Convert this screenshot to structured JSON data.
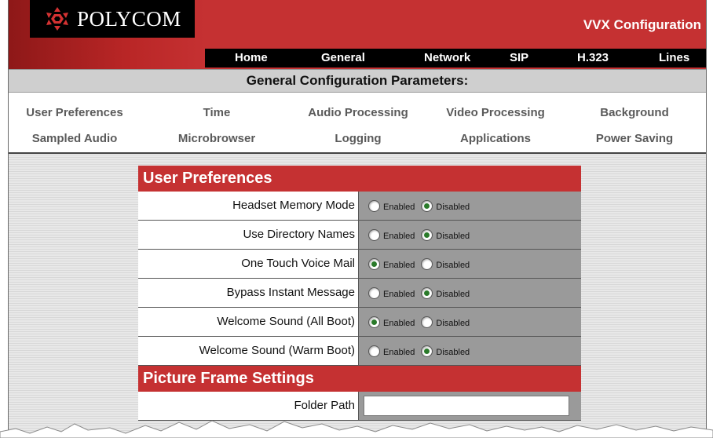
{
  "header": {
    "brand": "POLYCOM",
    "app_title": "VVX Configuration",
    "brand_color": "#c53132",
    "nav": [
      "Home",
      "General",
      "Network",
      "SIP",
      "H.323",
      "Lines"
    ]
  },
  "general": {
    "title": "General Configuration Parameters:",
    "row1": [
      "User Preferences",
      "Time",
      "Audio Processing",
      "Video Processing",
      "Background"
    ],
    "row2": [
      "Sampled Audio",
      "Microbrowser",
      "Logging",
      "Applications",
      "Power Saving"
    ]
  },
  "user_preferences": {
    "title": "User Preferences",
    "enabled_label": "Enabled",
    "disabled_label": "Disabled",
    "rows": [
      {
        "label": "Headset Memory Mode",
        "value": "Disabled"
      },
      {
        "label": "Use Directory Names",
        "value": "Disabled"
      },
      {
        "label": "One Touch Voice Mail",
        "value": "Enabled"
      },
      {
        "label": "Bypass Instant Message",
        "value": "Disabled"
      },
      {
        "label": "Welcome Sound (All Boot)",
        "value": "Enabled"
      },
      {
        "label": "Welcome Sound (Warm Boot)",
        "value": "Disabled"
      }
    ]
  },
  "picture_frame": {
    "title": "Picture Frame Settings",
    "folder_path_label": "Folder Path",
    "folder_path_value": ""
  }
}
